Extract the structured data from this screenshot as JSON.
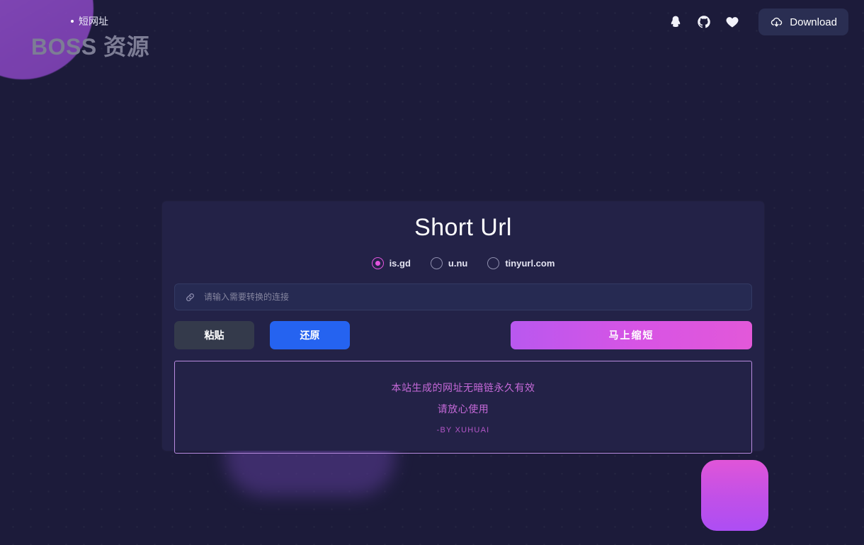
{
  "header": {
    "brand": "BOSS 资源",
    "nav_items": [
      {
        "label": "短网址",
        "icon": "dot-icon"
      }
    ],
    "icons": [
      {
        "name": "qq-icon",
        "label": "QQ"
      },
      {
        "name": "github-icon",
        "label": "GitHub"
      },
      {
        "name": "heart-icon",
        "label": "收藏"
      }
    ],
    "download_label": "Download",
    "download_icon": "cloud-download-icon"
  },
  "card": {
    "title": "Short Url",
    "providers": [
      {
        "value": "is.gd",
        "label": "is.gd",
        "checked": true
      },
      {
        "value": "u.nu",
        "label": "u.nu",
        "checked": false
      },
      {
        "value": "tinyurl.com",
        "label": "tinyurl.com",
        "checked": false
      }
    ],
    "input": {
      "placeholder": "请输入需要转换的连接",
      "value": "",
      "icon": "link-icon"
    },
    "buttons": {
      "paste": "粘贴",
      "restore": "还原",
      "shorten": "马上缩短"
    },
    "result": {
      "line1": "本站生成的网址无暗链永久有效",
      "line2": "请放心使用",
      "author": "-BY XUHUAI"
    }
  },
  "colors": {
    "page_bg": "#1c1b3a",
    "card_bg": "#232247",
    "accent_magenta": "#e254dd",
    "accent_purple": "#b958ef",
    "restore_blue": "#2563f0",
    "paste_gray": "#343a4b",
    "result_border": "#b98ce0",
    "result_text": "#c569d8",
    "brand_gray": "#7d7d95"
  }
}
